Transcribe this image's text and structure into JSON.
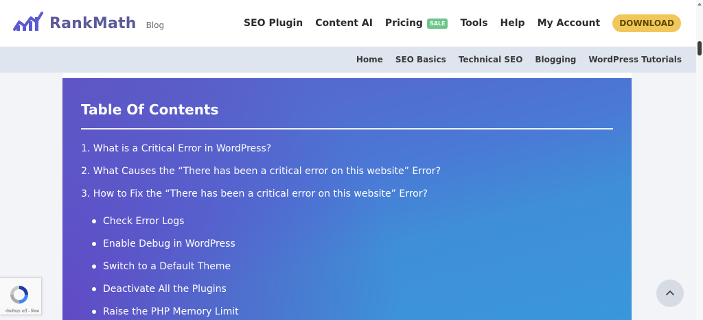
{
  "header": {
    "brand": "RankMath",
    "brand_sub": "Blog",
    "nav": [
      {
        "label": "SEO Plugin"
      },
      {
        "label": "Content AI"
      },
      {
        "label": "Pricing",
        "badge": "SALE"
      },
      {
        "label": "Tools"
      },
      {
        "label": "Help"
      },
      {
        "label": "My Account"
      }
    ],
    "download_label": "DOWNLOAD"
  },
  "subnav": {
    "items": [
      "Home",
      "SEO Basics",
      "Technical SEO",
      "Blogging",
      "WordPress Tutorials"
    ]
  },
  "toc": {
    "title": "Table Of Contents",
    "items": [
      "1. What is a Critical Error in WordPress?",
      "2. What Causes the “There has been a critical error on this website” Error?",
      "3. How to Fix the “There has been a critical error on this website” Error?"
    ],
    "subitems": [
      "Check Error Logs",
      "Enable Debug in WordPress",
      "Switch to a Default Theme",
      "Deactivate All the Plugins",
      "Raise the PHP Memory Limit"
    ]
  },
  "recaptcha": {
    "footer": "गोपनीयता शर्तें - नियम"
  },
  "colors": {
    "toc_gradient_start": "#5b5fc7",
    "toc_gradient_end": "#3a97da",
    "download_button": "#f1c75b",
    "sale_badge": "#6cc58a"
  },
  "icons": {
    "logo": "rankmath-logo-icon",
    "back_to_top": "chevron-up-icon",
    "recaptcha": "recaptcha-icon"
  }
}
